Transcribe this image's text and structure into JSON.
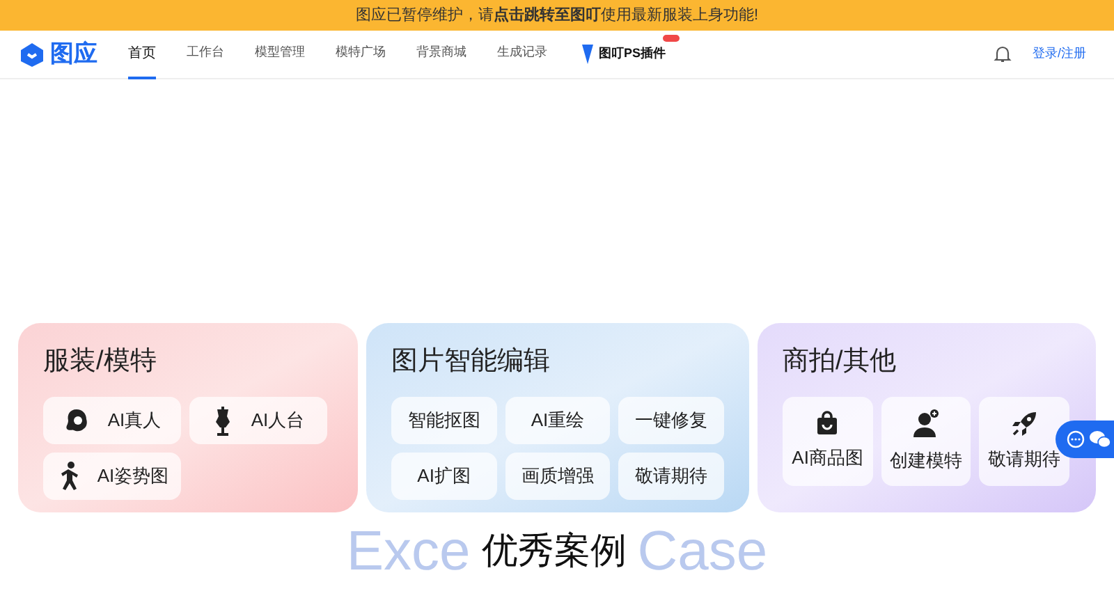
{
  "banner": {
    "text": "图应已暂停维护，请**点击跳转至图叮**使用最新服装上身功能!"
  },
  "logo": {
    "text": "图应"
  },
  "nav": [
    {
      "label": "首页",
      "selected": true,
      "kind": "text"
    },
    {
      "label": "工作台",
      "selected": false,
      "kind": "text"
    },
    {
      "label": "模型管理",
      "selected": false,
      "kind": "text"
    },
    {
      "label": "模特广场",
      "selected": false,
      "kind": "text"
    },
    {
      "label": "背景商城",
      "selected": false,
      "kind": "text"
    },
    {
      "label": "生成记录",
      "selected": false,
      "kind": "text"
    },
    {
      "label": "图叮PS插件",
      "selected": false,
      "kind": "plugin"
    }
  ],
  "login": "登录/注册",
  "categories": [
    {
      "title": "服装/模特",
      "items": [
        {
          "label": "AI真人"
        },
        {
          "label": "AI人台"
        },
        {
          "label": "AI姿势图"
        }
      ]
    },
    {
      "title": "图片智能编辑",
      "items": [
        {
          "label": "智能抠图"
        },
        {
          "label": "AI重绘"
        },
        {
          "label": "一键修复"
        },
        {
          "label": "AI扩图"
        },
        {
          "label": "画质增强"
        },
        {
          "label": "敬请期待"
        }
      ]
    },
    {
      "title": "商拍/其他",
      "items": [
        {
          "label": "AI商品图"
        },
        {
          "label": "创建模特"
        },
        {
          "label": "敬请期待"
        }
      ]
    }
  ],
  "section": {
    "title": "优秀案例",
    "background_text_left": "Exce",
    "background_text_right": "Case"
  }
}
